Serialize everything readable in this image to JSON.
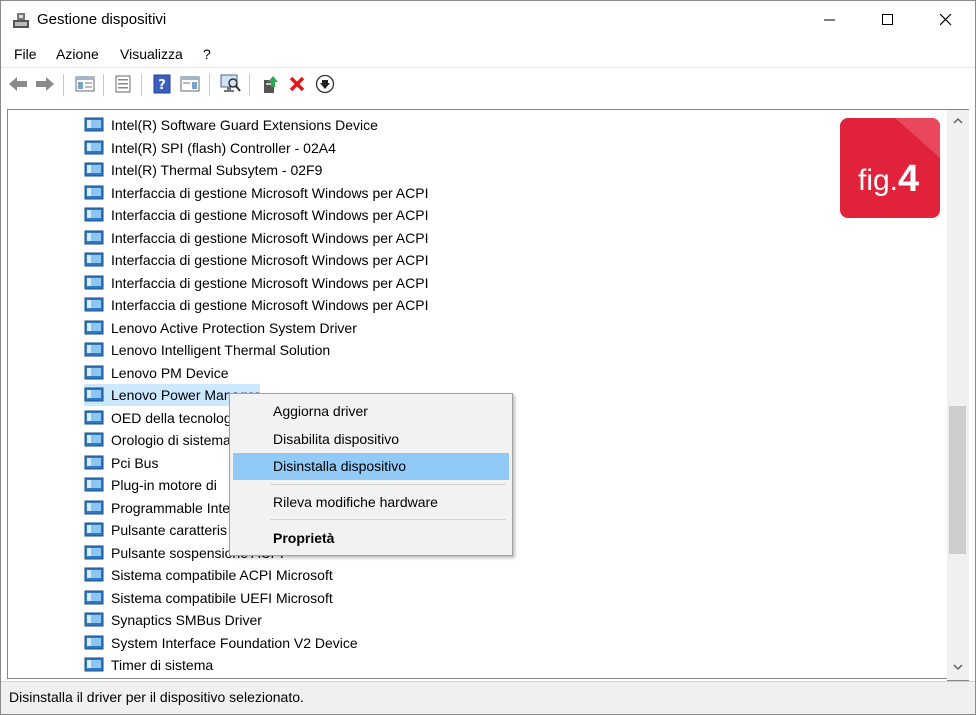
{
  "window": {
    "title": "Gestione dispositivi"
  },
  "menubar": {
    "items": [
      "File",
      "Azione",
      "Visualizza",
      "?"
    ]
  },
  "toolbar": {
    "buttons": [
      {
        "icon": "back-arrow-icon"
      },
      {
        "icon": "forward-arrow-icon"
      },
      {
        "icon": "show-hide-console-tree-icon"
      },
      {
        "icon": "properties-icon"
      },
      {
        "icon": "help-icon"
      },
      {
        "icon": "action-pane-icon"
      },
      {
        "icon": "scan-hardware-icon"
      },
      {
        "icon": "update-driver-icon"
      },
      {
        "icon": "uninstall-device-icon"
      },
      {
        "icon": "download-icon"
      }
    ]
  },
  "devices": [
    "Intel(R) Software Guard Extensions Device",
    "Intel(R) SPI (flash) Controller - 02A4",
    "Intel(R) Thermal Subsytem - 02F9",
    "Interfaccia di gestione Microsoft Windows per ACPI",
    "Interfaccia di gestione Microsoft Windows per ACPI",
    "Interfaccia di gestione Microsoft Windows per ACPI",
    "Interfaccia di gestione Microsoft Windows per ACPI",
    "Interfaccia di gestione Microsoft Windows per ACPI",
    "Interfaccia di gestione Microsoft Windows per ACPI",
    "Lenovo Active Protection System Driver",
    "Lenovo Intelligent Thermal Solution",
    "Lenovo PM Device",
    "Lenovo Power Manager",
    "OED della tecnologia",
    "Orologio di sistema",
    "Pci Bus",
    "Plug-in motore di",
    "Programmable Inte",
    "Pulsante caratteris",
    "Pulsante sospensione ACPI",
    "Sistema compatibile ACPI Microsoft",
    "Sistema compatibile UEFI Microsoft",
    "Synaptics SMBus Driver",
    "System Interface Foundation V2 Device",
    "Timer di sistema"
  ],
  "context_menu": {
    "update_driver": "Aggiorna driver",
    "disable_device": "Disabilita dispositivo",
    "uninstall_device": "Disinstalla dispositivo",
    "scan_hardware": "Rileva modifiche hardware",
    "properties": "Proprietà"
  },
  "status_bar": {
    "text": "Disinstalla il driver per il dispositivo selezionato."
  },
  "badge": {
    "fig": "fig.",
    "num": "4",
    "color": "#e0233b"
  },
  "colors": {
    "selection": "#cce8ff",
    "menu_highlight": "#91c9f7"
  }
}
